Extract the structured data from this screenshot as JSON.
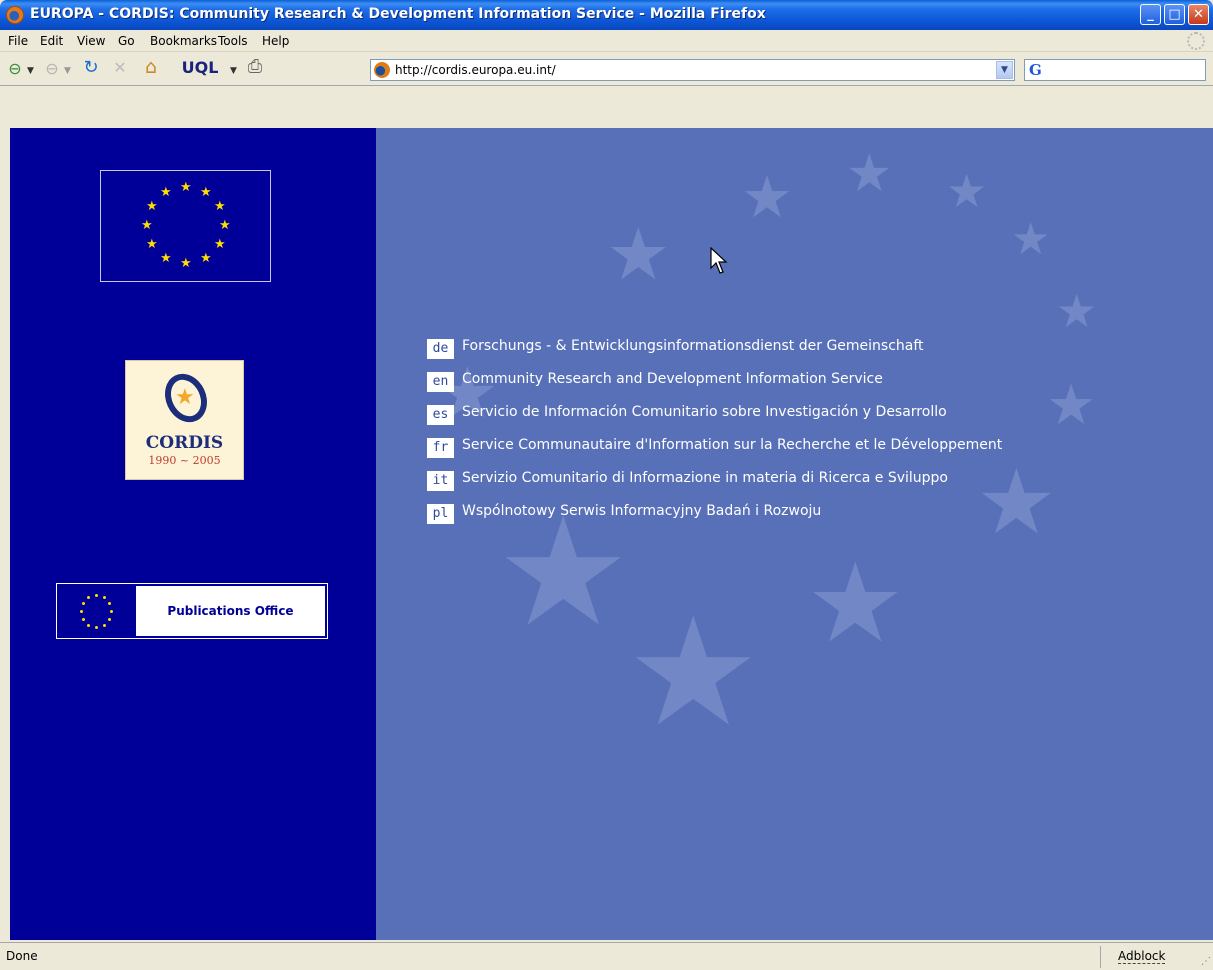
{
  "window": {
    "title": "EUROPA - CORDIS: Community Research & Development Information Service - Mozilla Firefox",
    "buttons": {
      "minimize": "_",
      "maximize": "□",
      "close": "✕"
    }
  },
  "menu": [
    "File",
    "Edit",
    "View",
    "Go",
    "Bookmarks",
    "Tools",
    "Help"
  ],
  "toolbar": {
    "back": "⊖",
    "forward": "⊖",
    "reload": "↻",
    "stop": "✕",
    "home": "⌂",
    "uql": "UQL",
    "print": "⎙",
    "url": "http://cordis.europa.eu.int/",
    "dropdown": "▼",
    "search_engine": "G"
  },
  "left_panel": {
    "cordis_word": "CORDIS",
    "cordis_years": "1990 ~ 2005",
    "publications_office": "Publications Office"
  },
  "languages": [
    {
      "code": "de",
      "label": "Forschungs - & Entwicklungsinformationsdienst der Gemeinschaft"
    },
    {
      "code": "en",
      "label": "Community Research and Development Information Service"
    },
    {
      "code": "es",
      "label": "Servicio de Información Comunitario sobre Investigación y Desarrollo"
    },
    {
      "code": "fr",
      "label": "Service Communautaire d'Information sur la Recherche et le Développement"
    },
    {
      "code": "it",
      "label": "Servizio Comunitario di Informazione in materia di Ricerca e Sviluppo"
    },
    {
      "code": "pl",
      "label": "Wspólnotowy Serwis Informacyjny Badań i Rozwoju"
    }
  ],
  "status": {
    "text": "Done",
    "adblock": "Adblock"
  },
  "colors": {
    "left_panel_bg": "#000099",
    "right_panel_bg": "#5870b8",
    "flag_star": "#ffdd00"
  }
}
